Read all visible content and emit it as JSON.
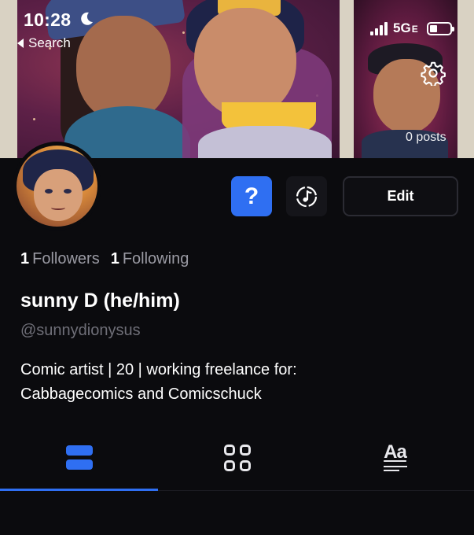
{
  "status_bar": {
    "time": "10:28",
    "back_label": "Search",
    "network": "5G",
    "network_suffix": "E"
  },
  "banner": {
    "posts_label": "0 posts"
  },
  "actions": {
    "help_label": "?",
    "edit_label": "Edit"
  },
  "profile": {
    "followers_count": "1",
    "followers_label": "Followers",
    "following_count": "1",
    "following_label": "Following",
    "display_name": "sunny D (he/him)",
    "handle": "@sunnydionysus",
    "bio_line1": "Comic artist | 20 | working freelance for:",
    "bio_line2": "Cabbagecomics and Comicschuck"
  },
  "tabs": {
    "text_tab_glyph": "Aa"
  },
  "colors": {
    "accent": "#2f6ff2",
    "background": "#0b0b0e",
    "muted_text": "#9a9aa3"
  }
}
